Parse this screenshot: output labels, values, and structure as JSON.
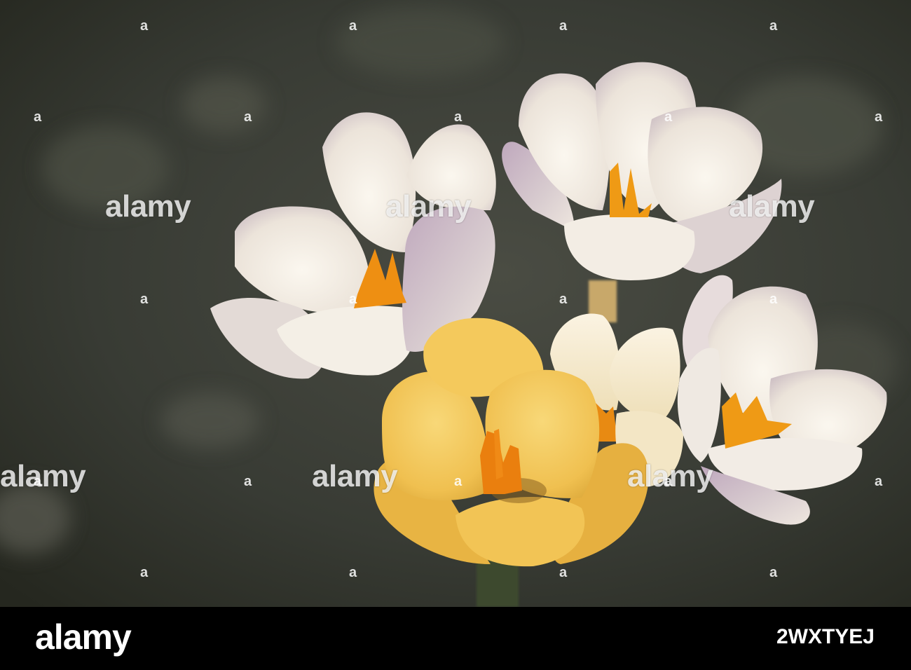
{
  "photo": {
    "subject": "crocus-flowers",
    "colors": {
      "background": "#3a3d36",
      "white_petal": "#f2ece4",
      "lilac_tint": "#b9a3b6",
      "yellow_petal": "#f2c45a",
      "stamen": "#e88a12"
    }
  },
  "watermark": {
    "text": "alamy",
    "marker": "a"
  },
  "footer": {
    "logo": "alamy",
    "image_id": "2WXTYEJ"
  }
}
